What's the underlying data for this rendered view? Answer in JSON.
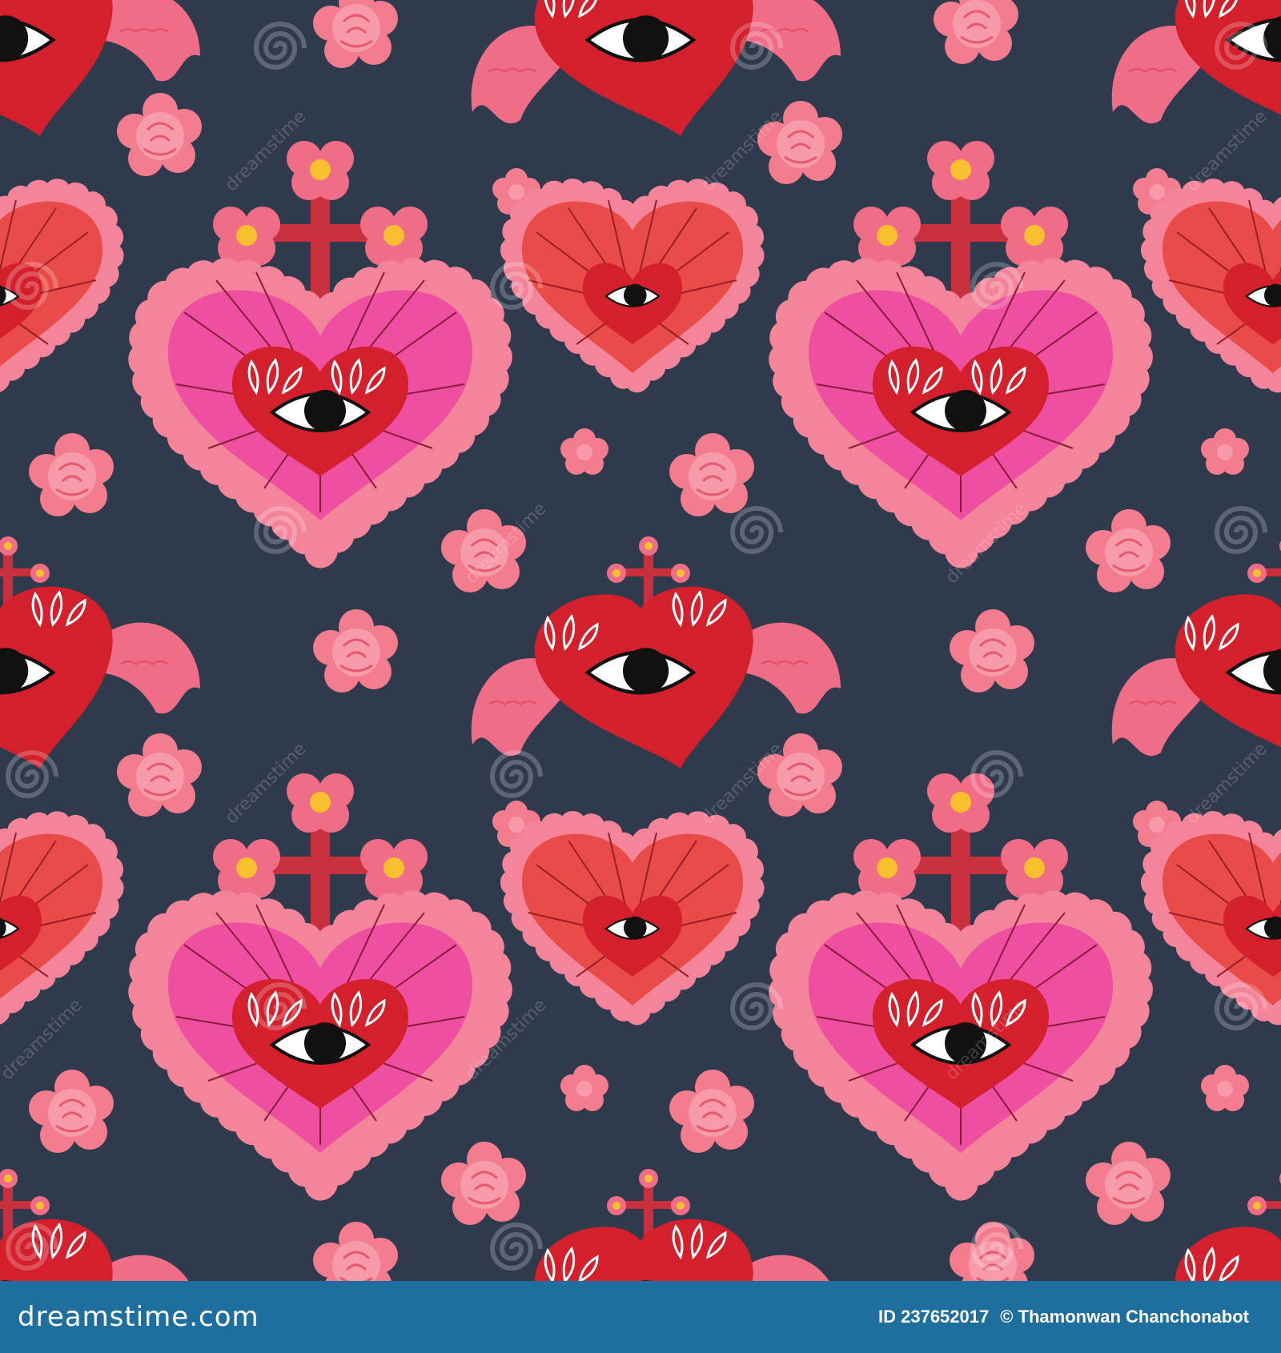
{
  "image": {
    "description_colors": {
      "background": "#2f3b4d",
      "hot_pink": "#ee4fa0",
      "salmon_pink": "#f06d88",
      "coral_red": "#e84b48",
      "crimson": "#d4202c",
      "lace_pink": "#f4849a",
      "rose": "#f47c8f",
      "yellow": "#f8c02e",
      "eye_black": "#111111"
    }
  },
  "watermark": {
    "text": "dreamstime"
  },
  "footer": {
    "brand": "dreamstime.com",
    "image_id": "ID 237652017",
    "author": "© Thamonwan  Chanchonabot",
    "background_color": "#1f6f9e"
  }
}
